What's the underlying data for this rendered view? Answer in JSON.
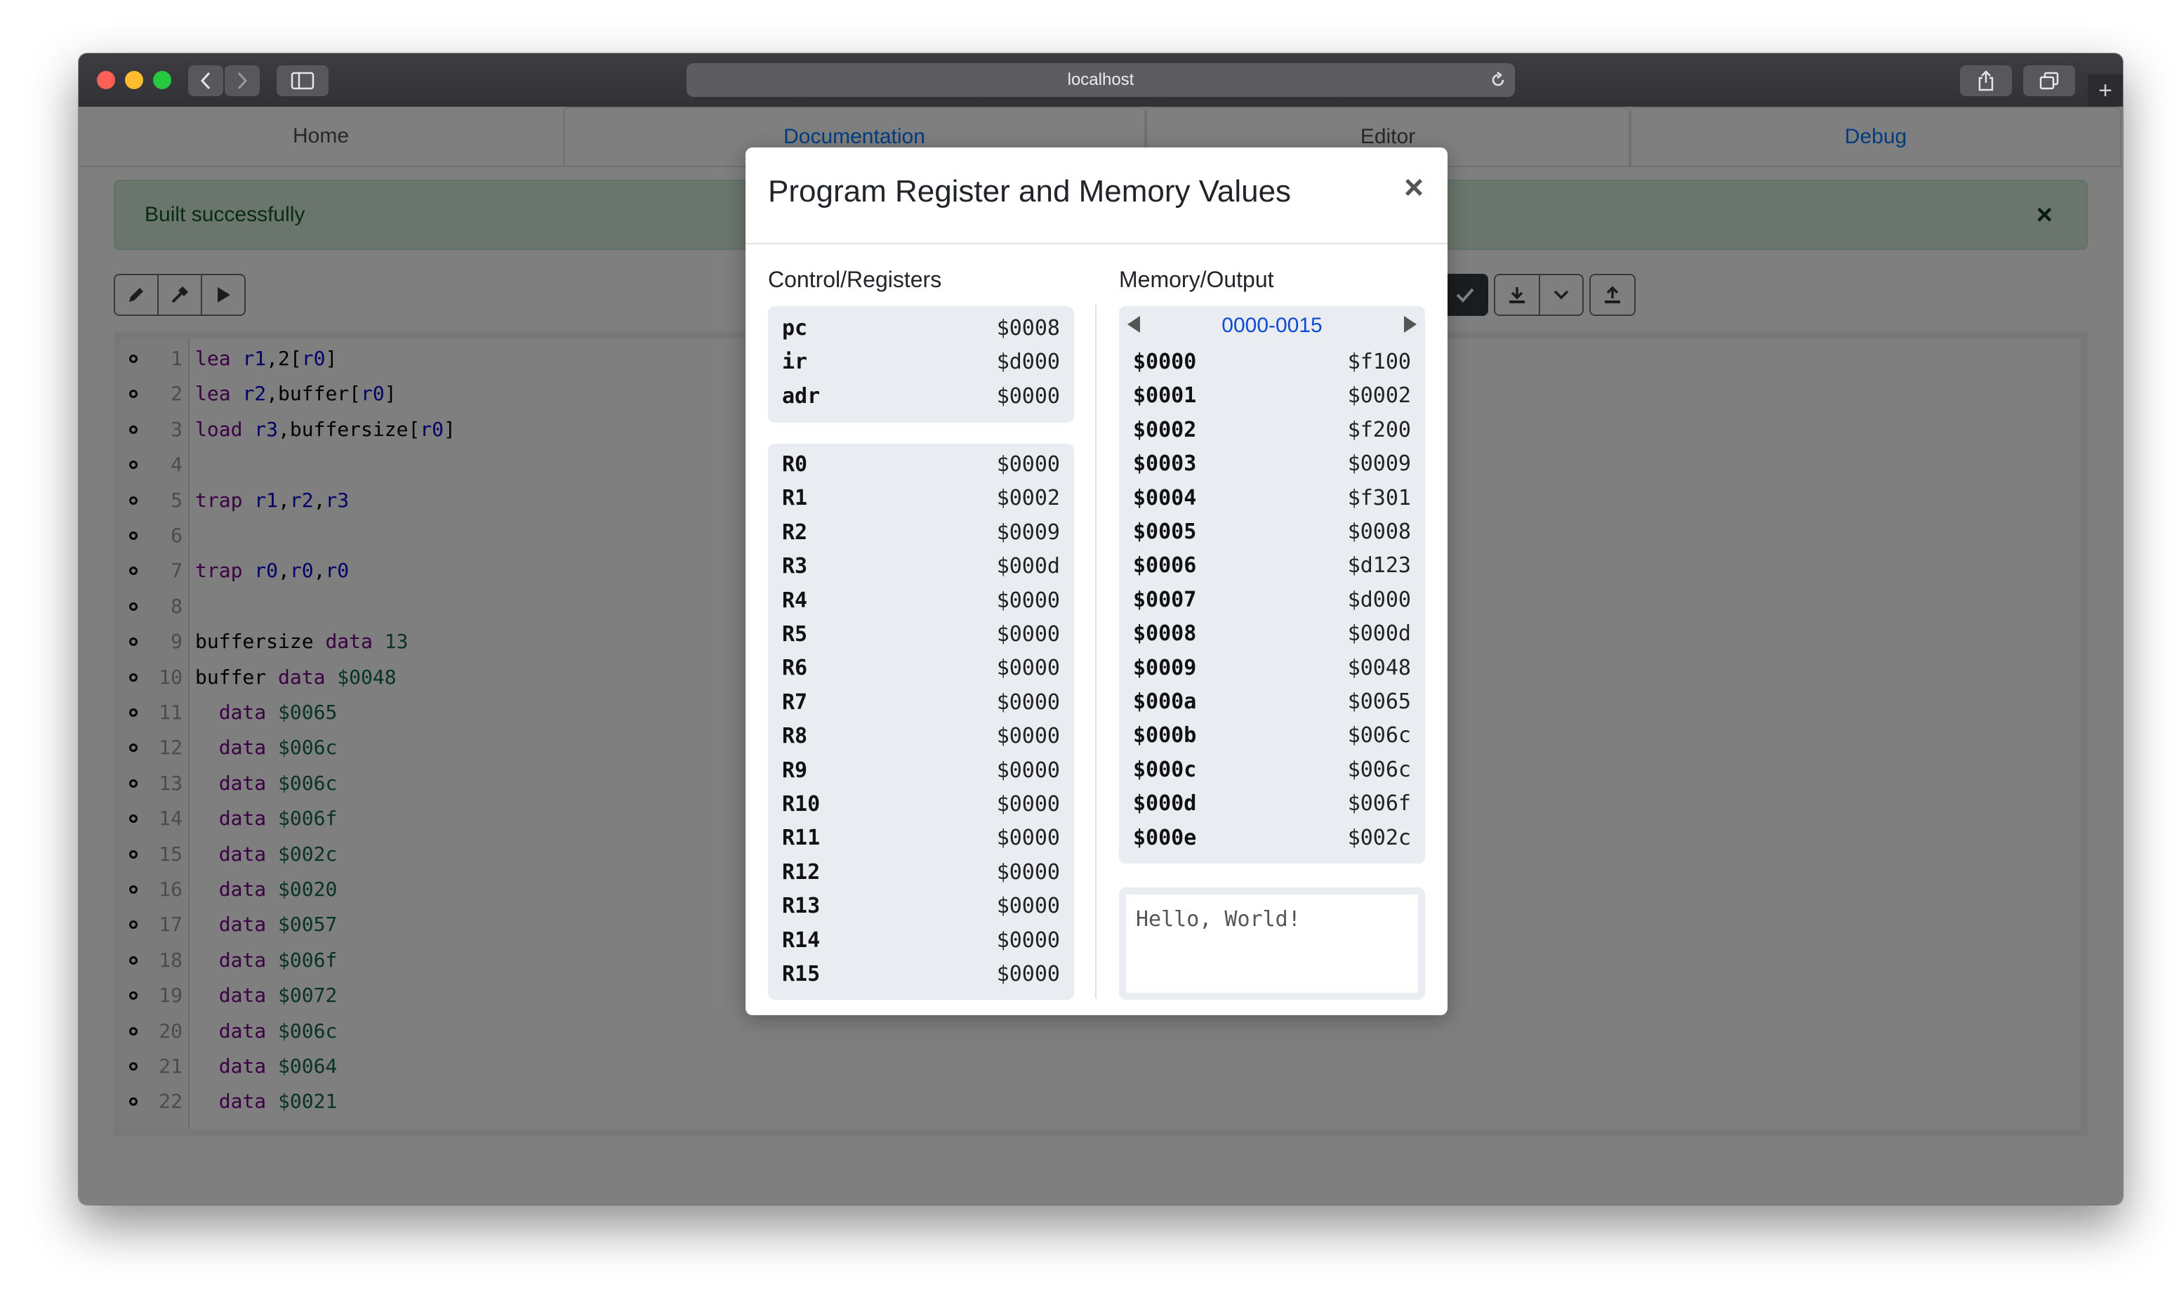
{
  "browser": {
    "url": "localhost"
  },
  "nav": {
    "tabs": [
      {
        "label": "Home"
      },
      {
        "label": "Documentation"
      },
      {
        "label": "Editor"
      },
      {
        "label": "Debug"
      }
    ]
  },
  "alert": {
    "message": "Built successfully",
    "close": "×"
  },
  "editor": {
    "lines": [
      {
        "n": "1",
        "tokens": [
          [
            "lea ",
            "kw"
          ],
          [
            "r1",
            "rg"
          ],
          [
            ",2[",
            ""
          ],
          [
            "r0",
            "rg"
          ],
          [
            "]",
            ""
          ]
        ]
      },
      {
        "n": "2",
        "tokens": [
          [
            "lea ",
            "kw"
          ],
          [
            "r2",
            "rg"
          ],
          [
            ",buffer[",
            ""
          ],
          [
            "r0",
            "rg"
          ],
          [
            "]",
            ""
          ]
        ]
      },
      {
        "n": "3",
        "tokens": [
          [
            "load ",
            "kw"
          ],
          [
            "r3",
            "rg"
          ],
          [
            ",buffersize[",
            ""
          ],
          [
            "r0",
            "rg"
          ],
          [
            "]",
            ""
          ]
        ]
      },
      {
        "n": "4",
        "tokens": []
      },
      {
        "n": "5",
        "tokens": [
          [
            "trap ",
            "kw"
          ],
          [
            "r1",
            "rg"
          ],
          [
            ",",
            ""
          ],
          [
            "r2",
            "rg"
          ],
          [
            ",",
            ""
          ],
          [
            "r3",
            "rg"
          ]
        ]
      },
      {
        "n": "6",
        "tokens": []
      },
      {
        "n": "7",
        "tokens": [
          [
            "trap ",
            "kw"
          ],
          [
            "r0",
            "rg"
          ],
          [
            ",",
            ""
          ],
          [
            "r0",
            "rg"
          ],
          [
            ",",
            ""
          ],
          [
            "r0",
            "rg"
          ]
        ]
      },
      {
        "n": "8",
        "tokens": []
      },
      {
        "n": "9",
        "tokens": [
          [
            "buffersize ",
            ""
          ],
          [
            "data ",
            "kw"
          ],
          [
            "13",
            "num"
          ]
        ]
      },
      {
        "n": "10",
        "tokens": [
          [
            "buffer ",
            ""
          ],
          [
            "data ",
            "kw"
          ],
          [
            "$0048",
            "num"
          ]
        ]
      },
      {
        "n": "11",
        "tokens": [
          [
            "  ",
            ""
          ],
          [
            "data ",
            "kw"
          ],
          [
            "$0065",
            "num"
          ]
        ]
      },
      {
        "n": "12",
        "tokens": [
          [
            "  ",
            ""
          ],
          [
            "data ",
            "kw"
          ],
          [
            "$006c",
            "num"
          ]
        ]
      },
      {
        "n": "13",
        "tokens": [
          [
            "  ",
            ""
          ],
          [
            "data ",
            "kw"
          ],
          [
            "$006c",
            "num"
          ]
        ]
      },
      {
        "n": "14",
        "tokens": [
          [
            "  ",
            ""
          ],
          [
            "data ",
            "kw"
          ],
          [
            "$006f",
            "num"
          ]
        ]
      },
      {
        "n": "15",
        "tokens": [
          [
            "  ",
            ""
          ],
          [
            "data ",
            "kw"
          ],
          [
            "$002c",
            "num"
          ]
        ]
      },
      {
        "n": "16",
        "tokens": [
          [
            "  ",
            ""
          ],
          [
            "data ",
            "kw"
          ],
          [
            "$0020",
            "num"
          ]
        ]
      },
      {
        "n": "17",
        "tokens": [
          [
            "  ",
            ""
          ],
          [
            "data ",
            "kw"
          ],
          [
            "$0057",
            "num"
          ]
        ]
      },
      {
        "n": "18",
        "tokens": [
          [
            "  ",
            ""
          ],
          [
            "data ",
            "kw"
          ],
          [
            "$006f",
            "num"
          ]
        ]
      },
      {
        "n": "19",
        "tokens": [
          [
            "  ",
            ""
          ],
          [
            "data ",
            "kw"
          ],
          [
            "$0072",
            "num"
          ]
        ]
      },
      {
        "n": "20",
        "tokens": [
          [
            "  ",
            ""
          ],
          [
            "data ",
            "kw"
          ],
          [
            "$006c",
            "num"
          ]
        ]
      },
      {
        "n": "21",
        "tokens": [
          [
            "  ",
            ""
          ],
          [
            "data ",
            "kw"
          ],
          [
            "$0064",
            "num"
          ]
        ]
      },
      {
        "n": "22",
        "tokens": [
          [
            "  ",
            ""
          ],
          [
            "data ",
            "kw"
          ],
          [
            "$0021",
            "num"
          ]
        ]
      }
    ]
  },
  "modal": {
    "title": "Program Register and Memory Values",
    "close": "×",
    "control_title": "Control/Registers",
    "memory_title": "Memory/Output",
    "control": [
      {
        "name": "pc",
        "value": "$0008"
      },
      {
        "name": "ir",
        "value": "$d000"
      },
      {
        "name": "adr",
        "value": "$0000"
      }
    ],
    "registers": [
      {
        "name": "R0",
        "value": "$0000"
      },
      {
        "name": "R1",
        "value": "$0002"
      },
      {
        "name": "R2",
        "value": "$0009"
      },
      {
        "name": "R3",
        "value": "$000d"
      },
      {
        "name": "R4",
        "value": "$0000"
      },
      {
        "name": "R5",
        "value": "$0000"
      },
      {
        "name": "R6",
        "value": "$0000"
      },
      {
        "name": "R7",
        "value": "$0000"
      },
      {
        "name": "R8",
        "value": "$0000"
      },
      {
        "name": "R9",
        "value": "$0000"
      },
      {
        "name": "R10",
        "value": "$0000"
      },
      {
        "name": "R11",
        "value": "$0000"
      },
      {
        "name": "R12",
        "value": "$0000"
      },
      {
        "name": "R13",
        "value": "$0000"
      },
      {
        "name": "R14",
        "value": "$0000"
      },
      {
        "name": "R15",
        "value": "$0000"
      }
    ],
    "memory_range": "0000-0015",
    "memory": [
      {
        "addr": "$0000",
        "value": "$f100"
      },
      {
        "addr": "$0001",
        "value": "$0002"
      },
      {
        "addr": "$0002",
        "value": "$f200"
      },
      {
        "addr": "$0003",
        "value": "$0009"
      },
      {
        "addr": "$0004",
        "value": "$f301"
      },
      {
        "addr": "$0005",
        "value": "$0008"
      },
      {
        "addr": "$0006",
        "value": "$d123"
      },
      {
        "addr": "$0007",
        "value": "$d000"
      },
      {
        "addr": "$0008",
        "value": "$000d"
      },
      {
        "addr": "$0009",
        "value": "$0048"
      },
      {
        "addr": "$000a",
        "value": "$0065"
      },
      {
        "addr": "$000b",
        "value": "$006c"
      },
      {
        "addr": "$000c",
        "value": "$006c"
      },
      {
        "addr": "$000d",
        "value": "$006f"
      },
      {
        "addr": "$000e",
        "value": "$002c"
      }
    ],
    "output": "Hello, World!"
  }
}
